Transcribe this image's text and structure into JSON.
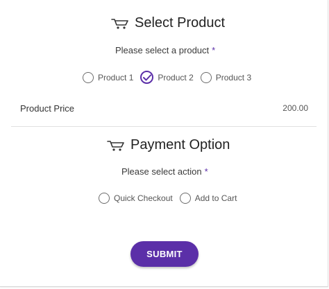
{
  "product_section": {
    "title": "Select Product",
    "prompt": "Please select a product",
    "required_mark": "*",
    "options": [
      {
        "label": "Product 1",
        "selected": false
      },
      {
        "label": "Product 2",
        "selected": true
      },
      {
        "label": "Product 3",
        "selected": false
      }
    ],
    "price_label": "Product Price",
    "price_value": "200.00"
  },
  "payment_section": {
    "title": "Payment Option",
    "prompt": "Please select action",
    "required_mark": "*",
    "options": [
      {
        "label": "Quick Checkout",
        "selected": false
      },
      {
        "label": "Add to Cart",
        "selected": false
      }
    ]
  },
  "submit_label": "SUBMIT",
  "icons": {
    "section_icon": "cart-icon",
    "selected_radio": "check-icon"
  },
  "colors": {
    "accent": "#5b2fa8",
    "button_text": "#ffffff"
  }
}
